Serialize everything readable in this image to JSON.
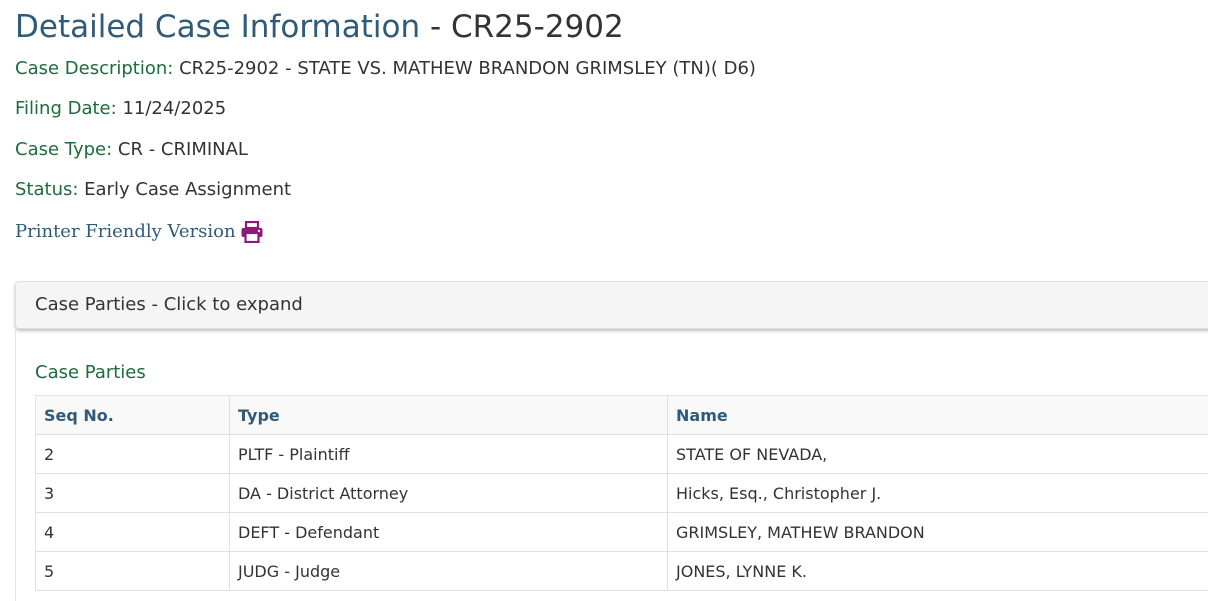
{
  "header": {
    "title_main": "Detailed Case Information",
    "title_sep": " - ",
    "case_number": "CR25-2902"
  },
  "case_info": {
    "description_label": "Case Description:",
    "description_value": "CR25-2902 - STATE VS. MATHEW BRANDON GRIMSLEY (TN)( D6)",
    "filing_date_label": "Filing Date:",
    "filing_date_value": "11/24/2025",
    "case_type_label": "Case Type:",
    "case_type_value": "CR - CRIMINAL",
    "status_label": "Status:",
    "status_value": "Early Case Assignment"
  },
  "printer": {
    "label": "Printer Friendly Version",
    "icon": "printer-icon",
    "icon_color": "#8b1a7a"
  },
  "accordion": {
    "header_label": "Case Parties - Click to expand"
  },
  "parties": {
    "section_title": "Case Parties",
    "columns": [
      "Seq No.",
      "Type",
      "Name"
    ],
    "rows": [
      {
        "seq": "2",
        "type": "PLTF - Plaintiff",
        "name": "STATE OF NEVADA,"
      },
      {
        "seq": "3",
        "type": "DA - District Attorney",
        "name": "Hicks, Esq., Christopher J."
      },
      {
        "seq": "4",
        "type": "DEFT - Defendant",
        "name": "GRIMSLEY, MATHEW BRANDON"
      },
      {
        "seq": "5",
        "type": "JUDG - Judge",
        "name": "JONES, LYNNE K."
      }
    ]
  },
  "colors": {
    "title": "#2f5a78",
    "label_green": "#1e6b3c",
    "text": "#333333"
  }
}
